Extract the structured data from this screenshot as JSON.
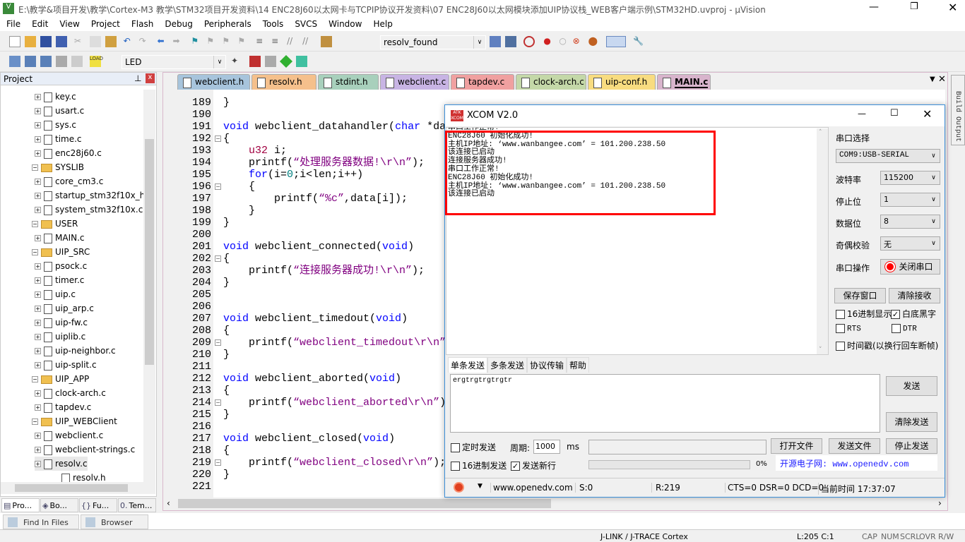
{
  "window": {
    "title": "E:\\教学&项目开发\\教学\\Cortex-M3 教学\\STM32项目开发资料\\14 ENC28J60以太网卡与TCPIP协议开发资料\\07 ENC28J60以太网模块添加UIP协议栈_WEB客户端示例\\STM32HD.uvproj - µVision"
  },
  "menu": [
    "File",
    "Edit",
    "View",
    "Project",
    "Flash",
    "Debug",
    "Peripherals",
    "Tools",
    "SVCS",
    "Window",
    "Help"
  ],
  "toolbar": {
    "find_combo": "resolv_found",
    "target_combo": "LED",
    "load_label": "LOAD"
  },
  "project": {
    "title": "Project",
    "items": [
      {
        "label": "key.c",
        "level": 2,
        "kind": "file"
      },
      {
        "label": "usart.c",
        "level": 2,
        "kind": "file"
      },
      {
        "label": "sys.c",
        "level": 2,
        "kind": "file"
      },
      {
        "label": "time.c",
        "level": 2,
        "kind": "file"
      },
      {
        "label": "enc28j60.c",
        "level": 2,
        "kind": "file"
      },
      {
        "label": "SYSLIB",
        "level": 1,
        "kind": "folder"
      },
      {
        "label": "core_cm3.c",
        "level": 2,
        "kind": "file"
      },
      {
        "label": "startup_stm32f10x_h",
        "level": 2,
        "kind": "file"
      },
      {
        "label": "system_stm32f10x.c",
        "level": 2,
        "kind": "file"
      },
      {
        "label": "USER",
        "level": 1,
        "kind": "folder"
      },
      {
        "label": "MAIN.c",
        "level": 2,
        "kind": "file"
      },
      {
        "label": "UIP_SRC",
        "level": 1,
        "kind": "folder"
      },
      {
        "label": "psock.c",
        "level": 2,
        "kind": "file"
      },
      {
        "label": "timer.c",
        "level": 2,
        "kind": "file"
      },
      {
        "label": "uip.c",
        "level": 2,
        "kind": "file"
      },
      {
        "label": "uip_arp.c",
        "level": 2,
        "kind": "file"
      },
      {
        "label": "uip-fw.c",
        "level": 2,
        "kind": "file"
      },
      {
        "label": "uiplib.c",
        "level": 2,
        "kind": "file"
      },
      {
        "label": "uip-neighbor.c",
        "level": 2,
        "kind": "file"
      },
      {
        "label": "uip-split.c",
        "level": 2,
        "kind": "file"
      },
      {
        "label": "UIP_APP",
        "level": 1,
        "kind": "folder"
      },
      {
        "label": "clock-arch.c",
        "level": 2,
        "kind": "file"
      },
      {
        "label": "tapdev.c",
        "level": 2,
        "kind": "file"
      },
      {
        "label": "UIP_WEBClient",
        "level": 1,
        "kind": "folder"
      },
      {
        "label": "webclient.c",
        "level": 2,
        "kind": "file"
      },
      {
        "label": "webclient-strings.c",
        "level": 2,
        "kind": "file"
      },
      {
        "label": "resolv.c",
        "level": 2,
        "kind": "file"
      },
      {
        "label": "resolv.h",
        "level": 3,
        "kind": "file"
      }
    ],
    "bottom_tabs": [
      "Pro...",
      "Bo...",
      "Fu...",
      "Tem..."
    ]
  },
  "editor": {
    "tabs": [
      {
        "label": "webclient.h",
        "color": "#a7c4dc"
      },
      {
        "label": "resolv.h",
        "color": "#f5c08c"
      },
      {
        "label": "stdint.h",
        "color": "#a8d0bc"
      },
      {
        "label": "webclient.c",
        "color": "#c8b4e4"
      },
      {
        "label": "tapdev.c",
        "color": "#f0a0a0"
      },
      {
        "label": "clock-arch.c",
        "color": "#c4d8a8"
      },
      {
        "label": "uip-conf.h",
        "color": "#f8dc80"
      },
      {
        "label": "MAIN.c",
        "color": "#d8b4cc",
        "active": true
      }
    ],
    "first_line": 189,
    "lines": [
      [
        [
          "}",
          ""
        ]
      ],
      [],
      [
        [
          "void",
          "kw"
        ],
        [
          " webclient_datahandler(",
          ""
        ],
        [
          "char",
          "kw"
        ],
        [
          " *da",
          ""
        ]
      ],
      [
        [
          "{",
          ""
        ]
      ],
      [
        [
          "    ",
          ""
        ],
        [
          "u32",
          "ty"
        ],
        [
          " i;",
          ""
        ]
      ],
      [
        [
          "    printf(",
          ""
        ],
        [
          "“处理服务器数据!\\r\\n”",
          "st"
        ],
        [
          ");",
          ""
        ]
      ],
      [
        [
          "    ",
          ""
        ],
        [
          "for",
          "kw"
        ],
        [
          "(i=",
          ""
        ],
        [
          "0",
          "nu"
        ],
        [
          ";i<len;i++)",
          ""
        ]
      ],
      [
        [
          "    {",
          ""
        ]
      ],
      [
        [
          "        printf(",
          ""
        ],
        [
          "“%c”",
          "st"
        ],
        [
          ",data[i]);",
          ""
        ]
      ],
      [
        [
          "    }",
          ""
        ]
      ],
      [
        [
          "}",
          ""
        ]
      ],
      [],
      [
        [
          "void",
          "kw"
        ],
        [
          " webclient_connected(",
          ""
        ],
        [
          "void",
          "kw"
        ],
        [
          ")",
          ""
        ]
      ],
      [
        [
          "{",
          ""
        ]
      ],
      [
        [
          "    printf(",
          ""
        ],
        [
          "“连接服务器成功!\\r\\n”",
          "st"
        ],
        [
          ");",
          ""
        ]
      ],
      [
        [
          "}",
          ""
        ]
      ],
      [],
      [],
      [
        [
          "void",
          "kw"
        ],
        [
          " webclient_timedout(",
          ""
        ],
        [
          "void",
          "kw"
        ],
        [
          ")",
          ""
        ]
      ],
      [
        [
          "{",
          ""
        ]
      ],
      [
        [
          "    printf(",
          ""
        ],
        [
          "“webclient_timedout\\r\\n”",
          "st"
        ]
      ],
      [
        [
          "}",
          ""
        ]
      ],
      [],
      [
        [
          "void",
          "kw"
        ],
        [
          " webclient_aborted(",
          ""
        ],
        [
          "void",
          "kw"
        ],
        [
          ")",
          ""
        ]
      ],
      [
        [
          "{",
          ""
        ]
      ],
      [
        [
          "    printf(",
          ""
        ],
        [
          "“webclient_aborted\\r\\n”",
          "st"
        ],
        [
          ")",
          ""
        ]
      ],
      [
        [
          "}",
          ""
        ]
      ],
      [],
      [
        [
          "void",
          "kw"
        ],
        [
          " webclient_closed(",
          ""
        ],
        [
          "void",
          "kw"
        ],
        [
          ")",
          ""
        ]
      ],
      [
        [
          "{",
          ""
        ]
      ],
      [
        [
          "    printf(",
          ""
        ],
        [
          "“webclient_closed\\r\\n”",
          "st"
        ],
        [
          ");",
          ""
        ]
      ],
      [
        [
          "}",
          ""
        ]
      ],
      []
    ]
  },
  "xcom": {
    "title": "XCOM V2.0",
    "logo": "ATK XCOM",
    "receive_lines": [
      "串口工作正常!",
      "ENC28J60 初始化成功!",
      "主机IP地址: ‘www.wanbangee.com’ = 101.200.238.50",
      "该连接已启动",
      "连接服务器成功!",
      "串口工作正常!",
      "ENC28J60 初始化成功!",
      "主机IP地址: ‘www.wanbangee.com’ = 101.200.238.50",
      "该连接已启动"
    ],
    "port_label": "串口选择",
    "port_value": "COM9:USB-SERIAL",
    "settings": [
      {
        "label": "波特率",
        "value": "115200"
      },
      {
        "label": "停止位",
        "value": "1"
      },
      {
        "label": "数据位",
        "value": "8"
      },
      {
        "label": "奇偶校验",
        "value": "无"
      }
    ],
    "op_label": "串口操作",
    "close_port": "关闭串口",
    "save_window": "保存窗口",
    "clear_recv": "清除接收",
    "hex_display": "16进制显示",
    "white_black": "白底黑字",
    "rts": "RTS",
    "dtr": "DTR",
    "timestamp": "时间戳(以换行回车断帧)",
    "hex_display_checked": false,
    "white_black_checked": true,
    "rts_checked": false,
    "dtr_checked": false,
    "timestamp_checked": false,
    "send_tabs": [
      "单条发送",
      "多条发送",
      "协议传输",
      "帮助"
    ],
    "send_text": "ergtrgtrgtrgtr",
    "send": "发送",
    "clear_send": "清除发送",
    "timed_send": "定时发送",
    "period_label": "周期:",
    "period_value": "1000",
    "ms": "ms",
    "open_file": "打开文件",
    "send_file": "发送文件",
    "stop_send": "停止发送",
    "hex_send": "16进制发送",
    "send_newline": "发送新行",
    "timed_send_checked": false,
    "hex_send_checked": false,
    "send_newline_checked": true,
    "progress": "0%",
    "progress_value": 0,
    "site": "开源电子网: www.openedv.com",
    "status": {
      "url": "www.openedv.com",
      "sent": "S:0",
      "recv": "R:219",
      "lines": "CTS=0 DSR=0 DCD=0",
      "time": "当前时间 17:37:07"
    }
  },
  "bottom": {
    "tabs": [
      "Find In Files",
      "Browser"
    ]
  },
  "right_panel": {
    "label": "Build Output"
  },
  "statusbar": {
    "debugger": "J-LINK / J-TRACE Cortex",
    "pos": "L:205 C:1",
    "flags": [
      "CAP",
      "NUM",
      "SCRL",
      "OVR",
      "R/W"
    ]
  }
}
